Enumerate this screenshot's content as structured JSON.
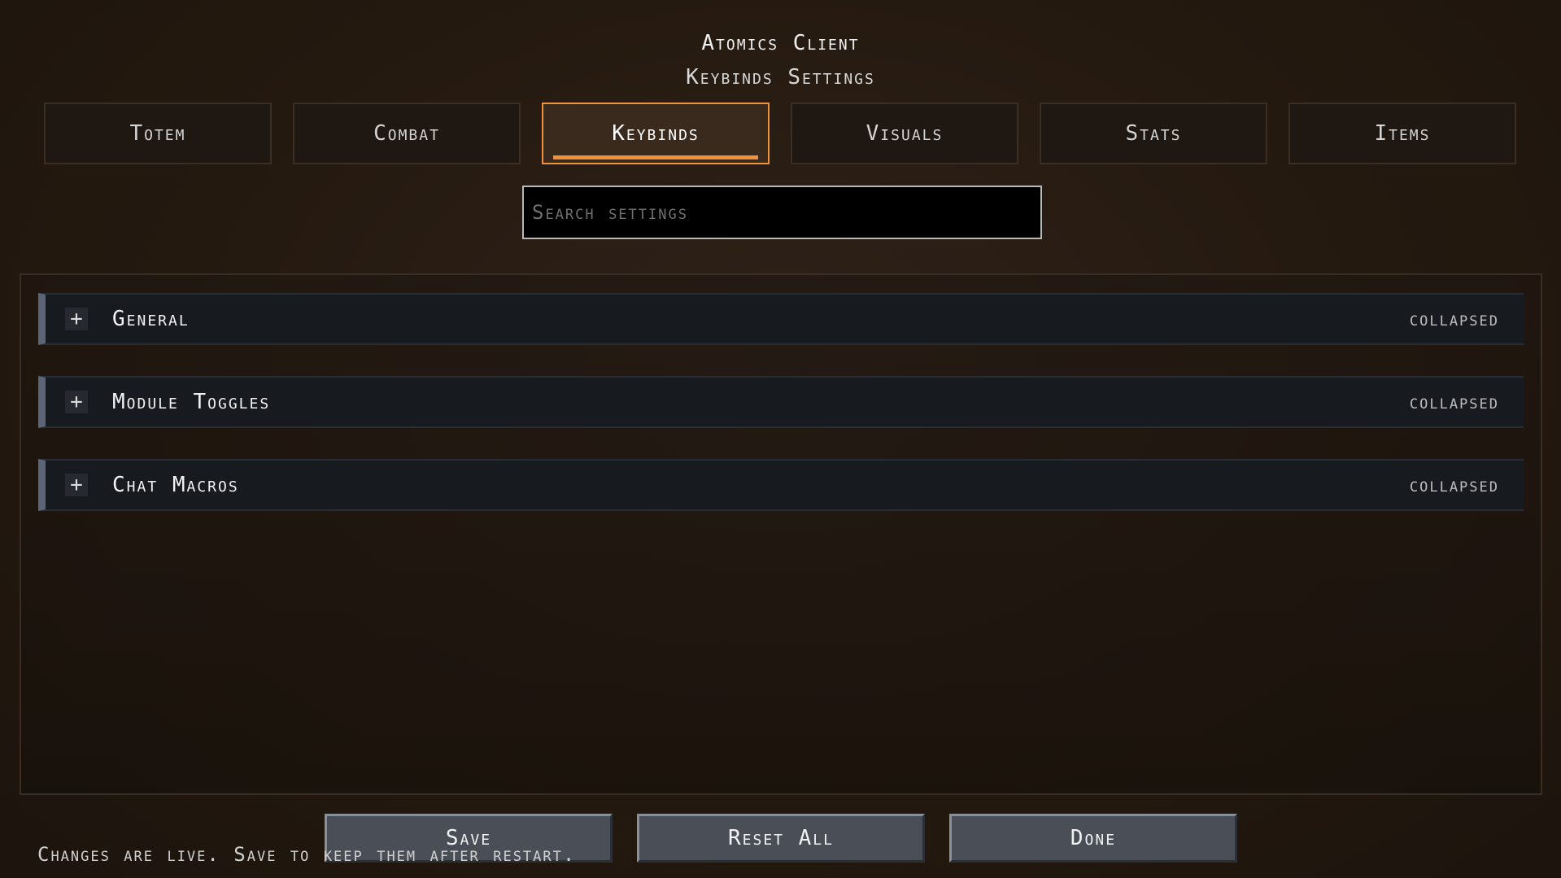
{
  "header": {
    "title": "Atomics Client",
    "subtitle": "Keybinds Settings"
  },
  "tabs": [
    {
      "label": "Totem"
    },
    {
      "label": "Combat"
    },
    {
      "label": "Keybinds",
      "active": true
    },
    {
      "label": "Visuals"
    },
    {
      "label": "Stats"
    },
    {
      "label": "Items"
    }
  ],
  "search": {
    "placeholder": "Search settings",
    "value": ""
  },
  "sections": [
    {
      "label": "General",
      "state": "collapsed",
      "icon": "plus-icon"
    },
    {
      "label": "Module Toggles",
      "state": "collapsed",
      "icon": "plus-icon"
    },
    {
      "label": "Chat Macros",
      "state": "collapsed",
      "icon": "plus-icon"
    }
  ],
  "buttons": {
    "save": "Save",
    "reset_all": "Reset All",
    "done": "Done"
  },
  "footer": {
    "hint": "Changes are live. Save to keep them after restart."
  },
  "colors": {
    "accent": "#f0923c",
    "row_bar": "#5b6575",
    "button": "#4a4f57"
  }
}
